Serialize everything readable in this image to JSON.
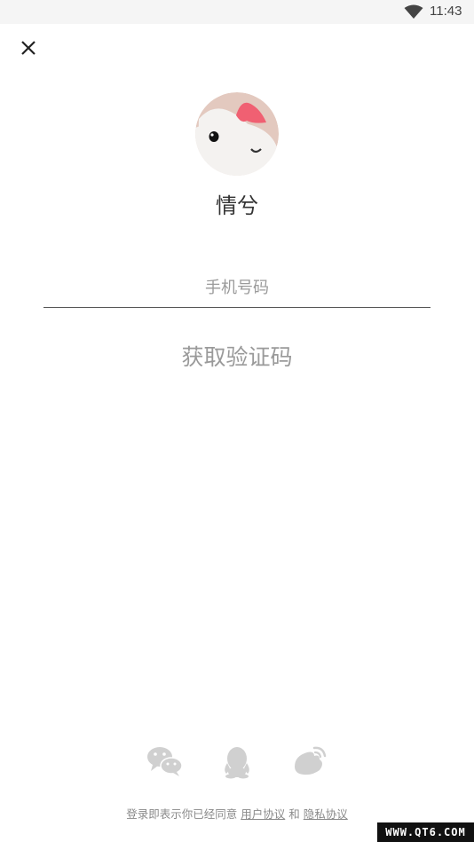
{
  "status_bar": {
    "time": "11:43",
    "wifi_icon": "wifi-icon"
  },
  "close_icon": "close-icon",
  "app": {
    "name": "情兮",
    "logo_icon": "app-logo"
  },
  "phone": {
    "placeholder": "手机号码",
    "value": ""
  },
  "get_code_label": "获取验证码",
  "social_login": [
    {
      "icon": "wechat-icon"
    },
    {
      "icon": "qq-icon"
    },
    {
      "icon": "weibo-icon"
    }
  ],
  "agreement": {
    "prefix": "登录即表示你已经同意",
    "user_agreement": "用户协议",
    "conjunction": "和",
    "privacy_agreement": "隐私协议"
  },
  "watermark": "WWW.QT6.COM",
  "colors": {
    "social_icon": "#d0d0d0",
    "muted_text": "#9a9a9a",
    "accent_pink": "#f06072"
  }
}
